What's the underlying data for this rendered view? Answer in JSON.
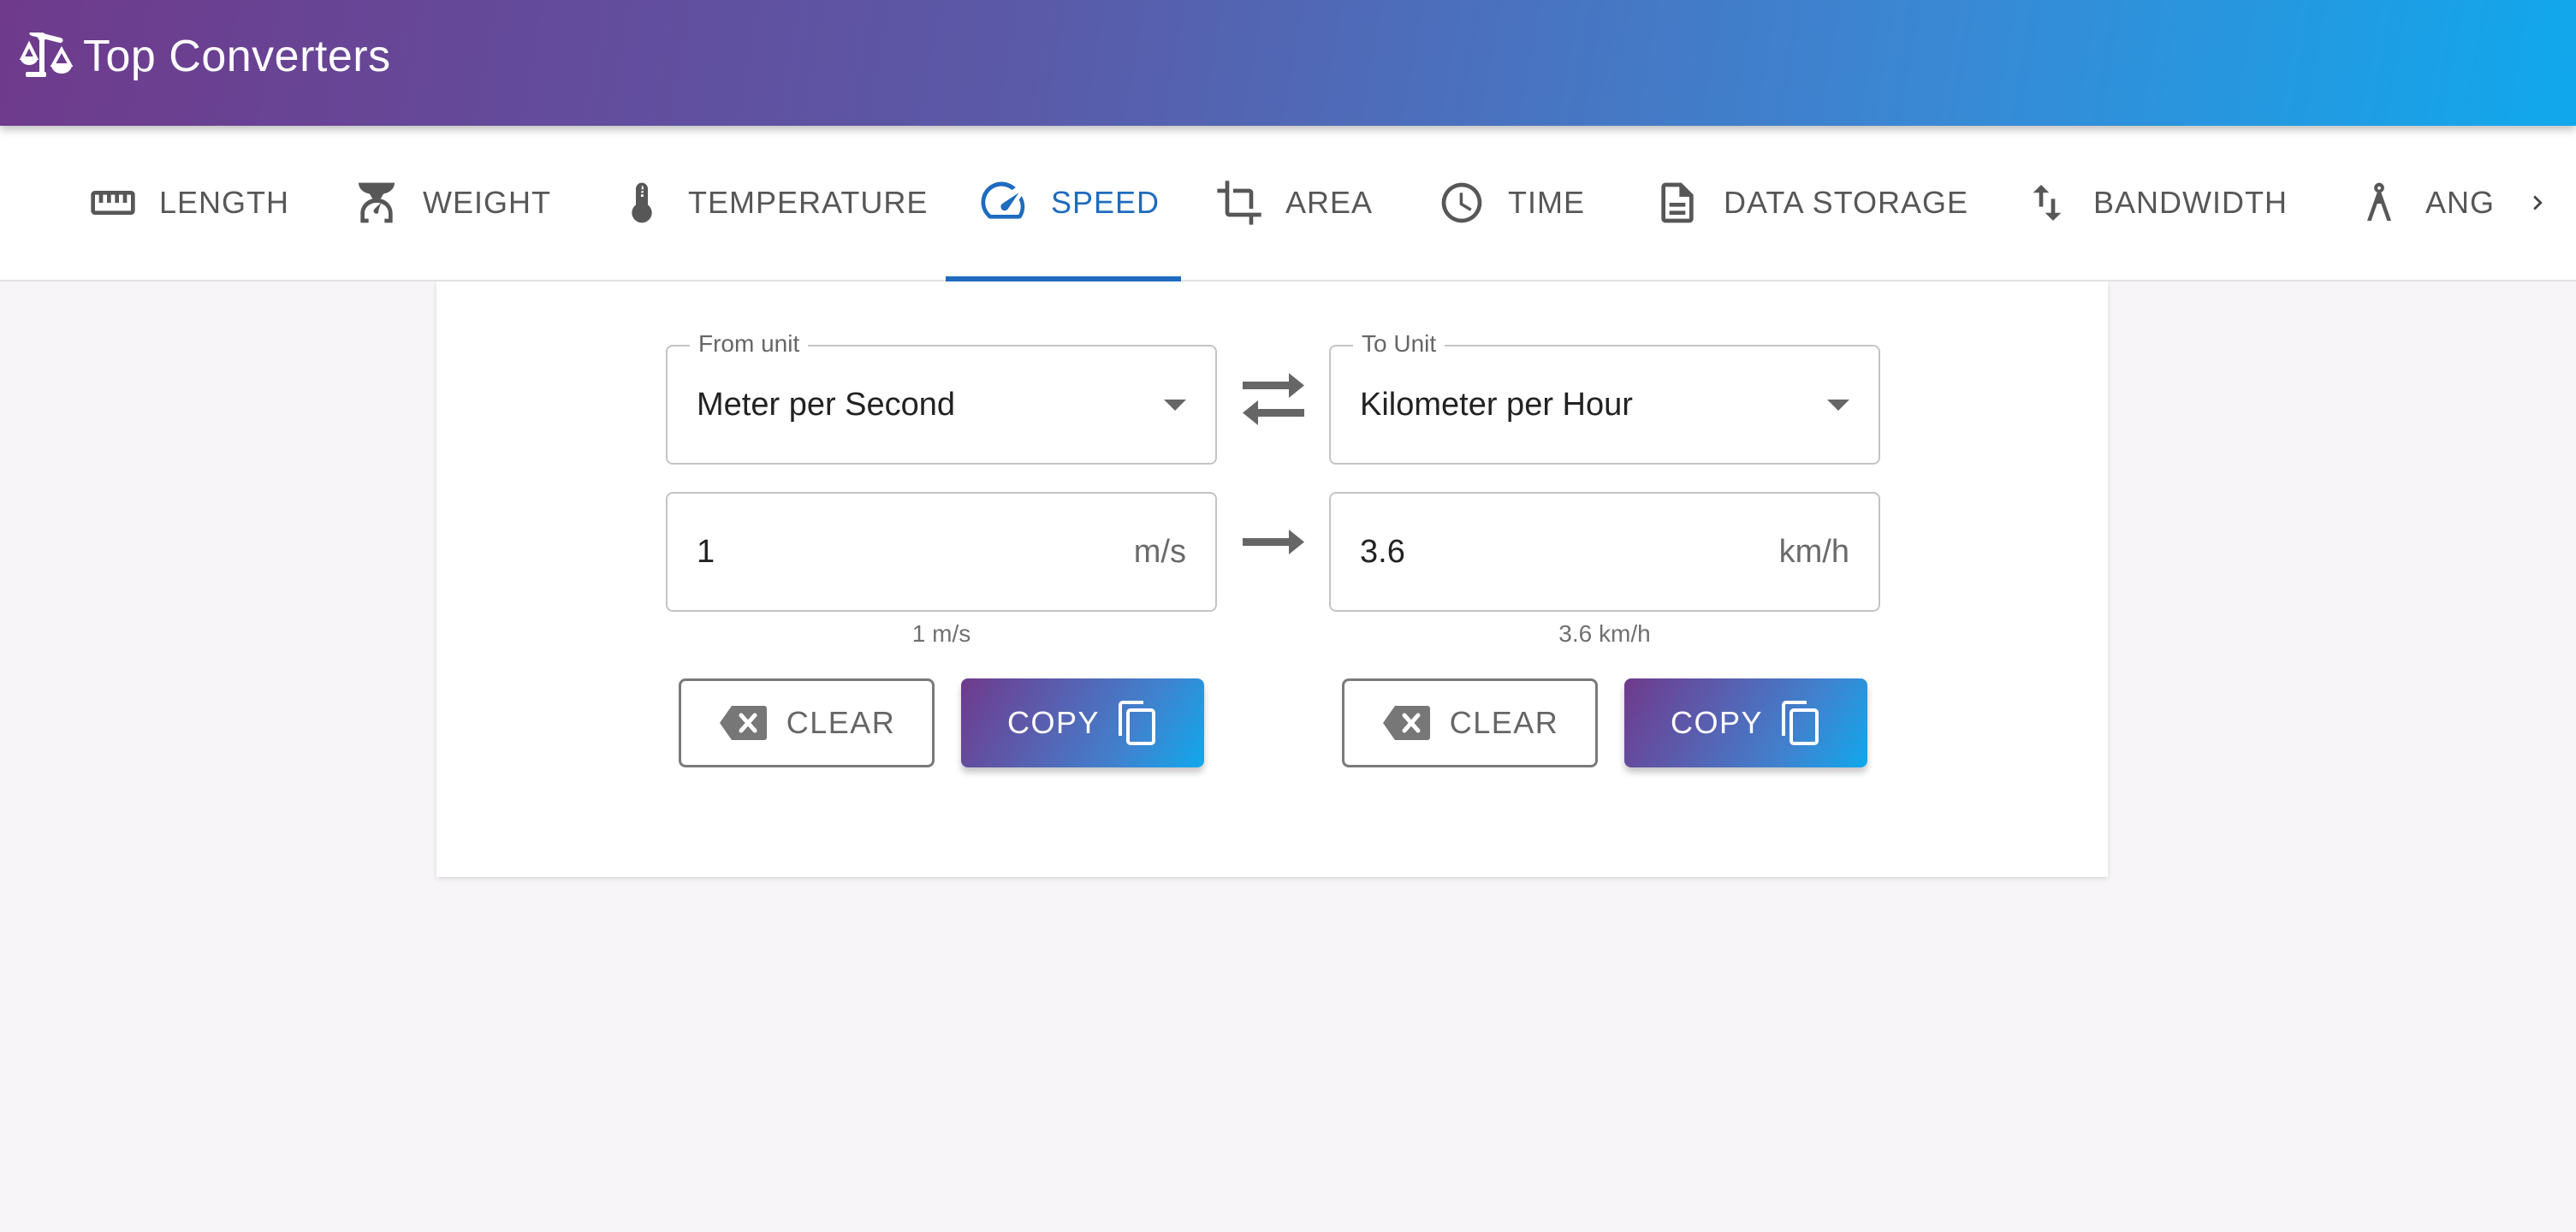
{
  "app": {
    "title": "Top Converters",
    "logo_icon": "balance-scale-icon",
    "colors": {
      "header_gradient_start": "#6f3a8c",
      "header_gradient_end": "#10a8ec",
      "active_tab": "#1e6bbf",
      "background": "#f7f5f8"
    }
  },
  "tabs": [
    {
      "label": "LENGTH",
      "icon": "ruler-icon",
      "active": false
    },
    {
      "label": "WEIGHT",
      "icon": "scale-icon",
      "active": false
    },
    {
      "label": "TEMPERATURE",
      "icon": "thermometer-icon",
      "active": false
    },
    {
      "label": "SPEED",
      "icon": "speedometer-icon",
      "active": true
    },
    {
      "label": "AREA",
      "icon": "crop-icon",
      "active": false
    },
    {
      "label": "TIME",
      "icon": "clock-icon",
      "active": false
    },
    {
      "label": "DATA STORAGE",
      "icon": "file-icon",
      "active": false
    },
    {
      "label": "BANDWIDTH",
      "icon": "swap-vertical-icon",
      "active": false
    },
    {
      "label": "ANG",
      "icon": "compass-icon",
      "active": false
    }
  ],
  "converter": {
    "from": {
      "label": "From unit",
      "selected_unit": "Meter per Second",
      "value": "1",
      "unit_symbol": "m/s",
      "helper": "1 m/s",
      "clear_label": "CLEAR",
      "copy_label": "COPY"
    },
    "to": {
      "label": "To Unit",
      "selected_unit": "Kilometer per Hour",
      "value": "3.6",
      "unit_symbol": "km/h",
      "helper": "3.6 km/h",
      "clear_label": "CLEAR",
      "copy_label": "COPY"
    }
  }
}
